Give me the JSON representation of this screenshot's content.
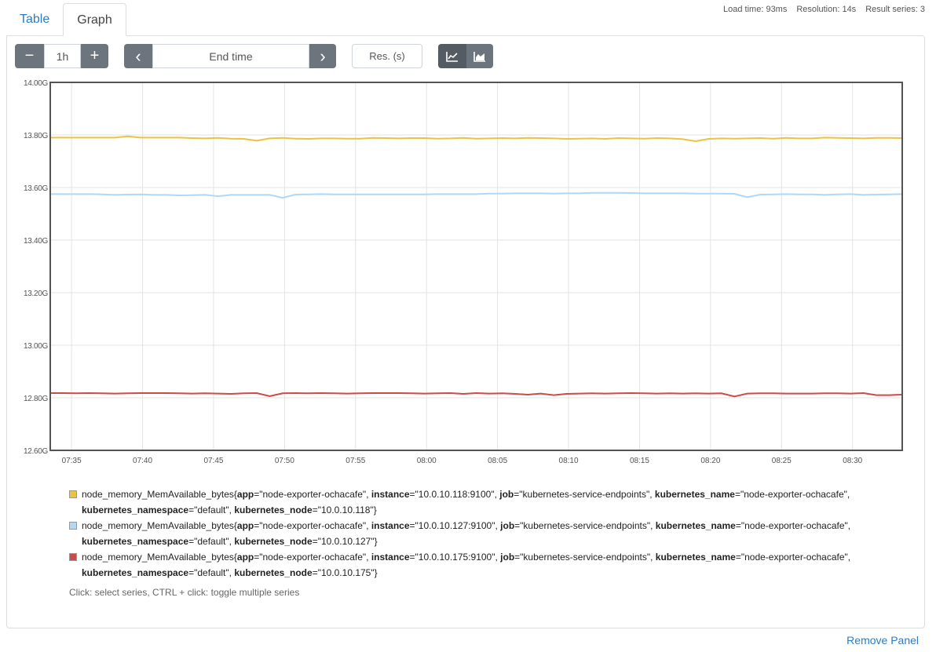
{
  "tabs": [
    {
      "label": "Table"
    },
    {
      "label": "Graph"
    }
  ],
  "stats": {
    "load_time": "Load time: 93ms",
    "resolution": "Resolution: 14s",
    "result_series": "Result series: 3"
  },
  "controls": {
    "minus": "−",
    "range": "1h",
    "plus": "+",
    "prev": "‹",
    "end_time_placeholder": "End time",
    "next": "›",
    "res_placeholder": "Res. (s)",
    "stacked_off_icon": "line-chart-icon",
    "stacked_on_icon": "area-chart-icon"
  },
  "chart_data": {
    "type": "line",
    "y_ticks": [
      "14.00G",
      "13.80G",
      "13.60G",
      "13.40G",
      "13.20G",
      "13.00G",
      "12.80G",
      "12.60G"
    ],
    "x_ticks": [
      "07:35",
      "07:40",
      "07:45",
      "07:50",
      "07:55",
      "08:00",
      "08:05",
      "08:10",
      "08:15",
      "08:20",
      "08:25",
      "08:30"
    ],
    "ylim": [
      12.6,
      14.0
    ],
    "x_range": [
      "07:33:30",
      "08:33:30"
    ],
    "grid": true,
    "series": [
      {
        "color": "#edc240",
        "values": [
          13.79,
          13.79,
          13.79,
          13.79,
          13.79,
          13.79,
          13.795,
          13.79,
          13.79,
          13.79,
          13.79,
          13.788,
          13.787,
          13.789,
          13.786,
          13.785,
          13.778,
          13.787,
          13.789,
          13.786,
          13.785,
          13.787,
          13.787,
          13.786,
          13.786,
          13.789,
          13.788,
          13.787,
          13.788,
          13.788,
          13.786,
          13.787,
          13.789,
          13.786,
          13.787,
          13.788,
          13.787,
          13.789,
          13.788,
          13.787,
          13.785,
          13.786,
          13.787,
          13.785,
          13.788,
          13.787,
          13.786,
          13.788,
          13.787,
          13.784,
          13.776,
          13.785,
          13.787,
          13.786,
          13.787,
          13.788,
          13.786,
          13.789,
          13.787,
          13.787,
          13.79,
          13.789,
          13.788,
          13.787,
          13.789,
          13.789,
          13.788
        ]
      },
      {
        "color": "#afd8f8",
        "values": [
          13.575,
          13.575,
          13.575,
          13.575,
          13.574,
          13.572,
          13.573,
          13.574,
          13.572,
          13.572,
          13.57,
          13.571,
          13.572,
          13.567,
          13.572,
          13.572,
          13.572,
          13.572,
          13.561,
          13.573,
          13.574,
          13.575,
          13.574,
          13.574,
          13.574,
          13.574,
          13.574,
          13.574,
          13.574,
          13.574,
          13.575,
          13.575,
          13.575,
          13.575,
          13.577,
          13.577,
          13.578,
          13.578,
          13.578,
          13.577,
          13.578,
          13.578,
          13.58,
          13.58,
          13.58,
          13.579,
          13.578,
          13.578,
          13.578,
          13.578,
          13.577,
          13.577,
          13.577,
          13.576,
          13.563,
          13.573,
          13.574,
          13.575,
          13.574,
          13.574,
          13.572,
          13.574,
          13.575,
          13.572,
          13.573,
          13.574,
          13.575
        ]
      },
      {
        "color": "#cb4b4b",
        "values": [
          12.818,
          12.818,
          12.817,
          12.818,
          12.817,
          12.816,
          12.817,
          12.818,
          12.818,
          12.818,
          12.817,
          12.816,
          12.817,
          12.816,
          12.815,
          12.817,
          12.818,
          12.806,
          12.817,
          12.818,
          12.817,
          12.818,
          12.817,
          12.816,
          12.817,
          12.818,
          12.818,
          12.818,
          12.817,
          12.816,
          12.817,
          12.818,
          12.815,
          12.818,
          12.816,
          12.817,
          12.815,
          12.812,
          12.816,
          12.81,
          12.815,
          12.816,
          12.817,
          12.816,
          12.817,
          12.818,
          12.817,
          12.816,
          12.817,
          12.816,
          12.817,
          12.816,
          12.817,
          12.805,
          12.816,
          12.817,
          12.817,
          12.816,
          12.816,
          12.816,
          12.817,
          12.817,
          12.816,
          12.818,
          12.81,
          12.81,
          12.812
        ]
      }
    ]
  },
  "legend": [
    {
      "color": "#edc240",
      "metric": "node_memory_MemAvailable_bytes{",
      "app_k": "app",
      "app_v": "=\"node-exporter-ochacafe\", ",
      "inst_k": "instance",
      "inst_v": "=\"10.0.10.118:9100\", ",
      "job_k": "job",
      "job_v": "=\"kubernetes-service-endpoints\", ",
      "kn_k": "kubernetes_name",
      "kn_v": "=\"node-exporter-ochacafe\",",
      "ns_k": "kubernetes_namespace",
      "ns_v": "=\"default\", ",
      "node_k": "kubernetes_node",
      "node_v": "=\"10.0.10.118\"}"
    },
    {
      "color": "#afd8f8",
      "metric": "node_memory_MemAvailable_bytes{",
      "app_k": "app",
      "app_v": "=\"node-exporter-ochacafe\", ",
      "inst_k": "instance",
      "inst_v": "=\"10.0.10.127:9100\", ",
      "job_k": "job",
      "job_v": "=\"kubernetes-service-endpoints\", ",
      "kn_k": "kubernetes_name",
      "kn_v": "=\"node-exporter-ochacafe\",",
      "ns_k": "kubernetes_namespace",
      "ns_v": "=\"default\", ",
      "node_k": "kubernetes_node",
      "node_v": "=\"10.0.10.127\"}"
    },
    {
      "color": "#cb4b4b",
      "metric": "node_memory_MemAvailable_bytes{",
      "app_k": "app",
      "app_v": "=\"node-exporter-ochacafe\", ",
      "inst_k": "instance",
      "inst_v": "=\"10.0.10.175:9100\", ",
      "job_k": "job",
      "job_v": "=\"kubernetes-service-endpoints\", ",
      "kn_k": "kubernetes_name",
      "kn_v": "=\"node-exporter-ochacafe\",",
      "ns_k": "kubernetes_namespace",
      "ns_v": "=\"default\", ",
      "node_k": "kubernetes_node",
      "node_v": "=\"10.0.10.175\"}"
    }
  ],
  "hint": "Click: select series, CTRL + click: toggle multiple series",
  "remove_panel": "Remove Panel"
}
